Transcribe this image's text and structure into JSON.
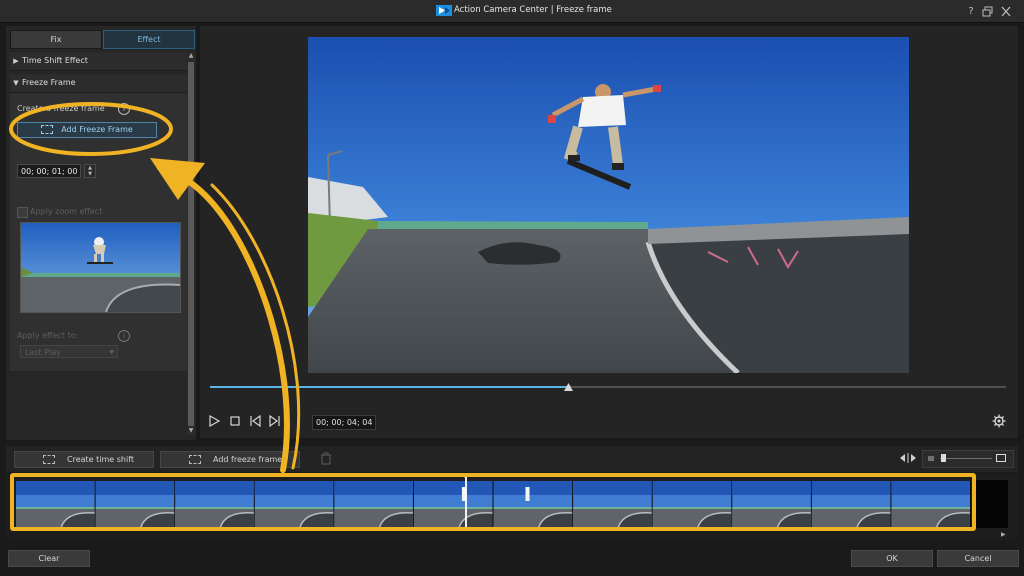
{
  "window": {
    "title": "Action Camera Center  |  Freeze frame",
    "help_label": "?",
    "brand_color": "#1d8fe0"
  },
  "left_panel": {
    "tabs": [
      {
        "label": "Fix",
        "active": false
      },
      {
        "label": "Effect",
        "active": true
      }
    ],
    "sections": [
      {
        "label": "Time Shift Effect",
        "expanded": false
      },
      {
        "label": "Freeze Frame",
        "expanded": true
      }
    ],
    "freeze_frame": {
      "create_label": "Create a freeze frame",
      "add_button_label": "Add Freeze Frame",
      "duration_value": "00; 00; 01; 00",
      "zoom_label": "Apply zoom effect",
      "apply_label": "Apply effect to:",
      "apply_value": "Last Play"
    }
  },
  "preview": {
    "timecode": "00; 00; 04; 04",
    "progress": 0.45
  },
  "timeline": {
    "create_time_shift_label": "Create time shift",
    "add_freeze_frame_label": "Add freeze frame",
    "frame_count": 12
  },
  "footer": {
    "clear_label": "Clear",
    "ok_label": "OK",
    "cancel_label": "Cancel"
  },
  "annotation_color": "#f0b323"
}
